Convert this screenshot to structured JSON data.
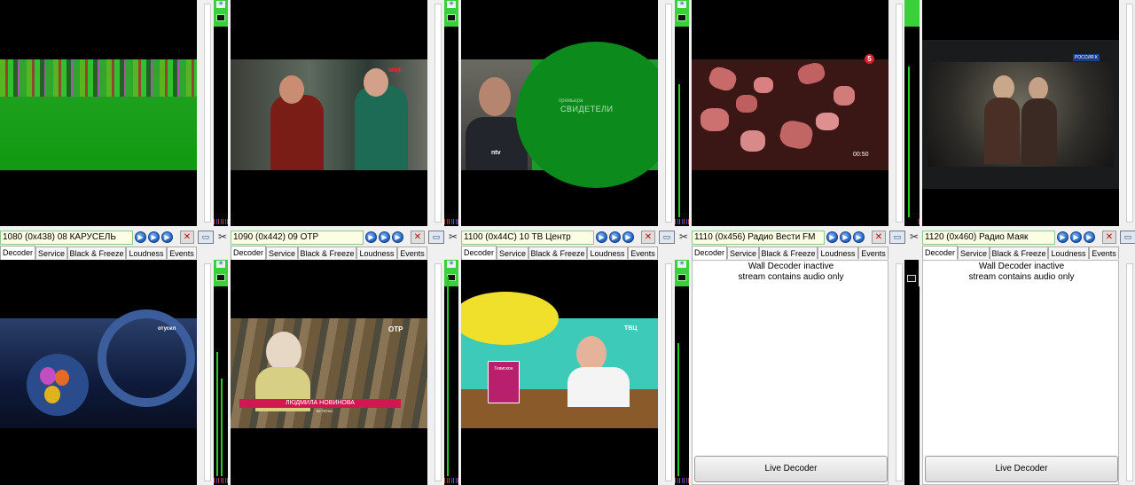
{
  "top_row": [
    {
      "title": "1080 (0x438) 08 КАРУСЕЛЬ"
    },
    {
      "title": "1090 (0x442) 09 ОТР"
    },
    {
      "title": "1100 (0x44C) 10 ТВ Центр"
    },
    {
      "title": "1110 (0x456) Радио Вести FM"
    },
    {
      "title": "1120 (0x460) Радио Маяк"
    }
  ],
  "tabs": [
    "Decoder",
    "Service",
    "Black & Freeze",
    "Loudness",
    "Events"
  ],
  "overlays": {
    "otr_logo": "мир",
    "svideteli": "СВИДЕТЕЛИ",
    "svideteli_top": "премьера",
    "tvc_corner": "ntv",
    "timer": "00:50",
    "channel5": "5",
    "russia": "РОССИЯ К",
    "karusel_logo": "отусел",
    "otr_small": "ОТР",
    "lower_third_name": "ЛЮДМИЛА НОВИНОВА",
    "lower_third_sub": "ВЕТЕРАН",
    "tvc_logo": "ТВЦ",
    "package": "Гевискон"
  },
  "audio_panel": {
    "line1": "Wall Decoder inactive",
    "line2": "stream contains audio only",
    "button": "Live Decoder"
  },
  "icons": {
    "play": "►",
    "mute": "🔇",
    "monitor": "▭",
    "tool": "✕"
  }
}
